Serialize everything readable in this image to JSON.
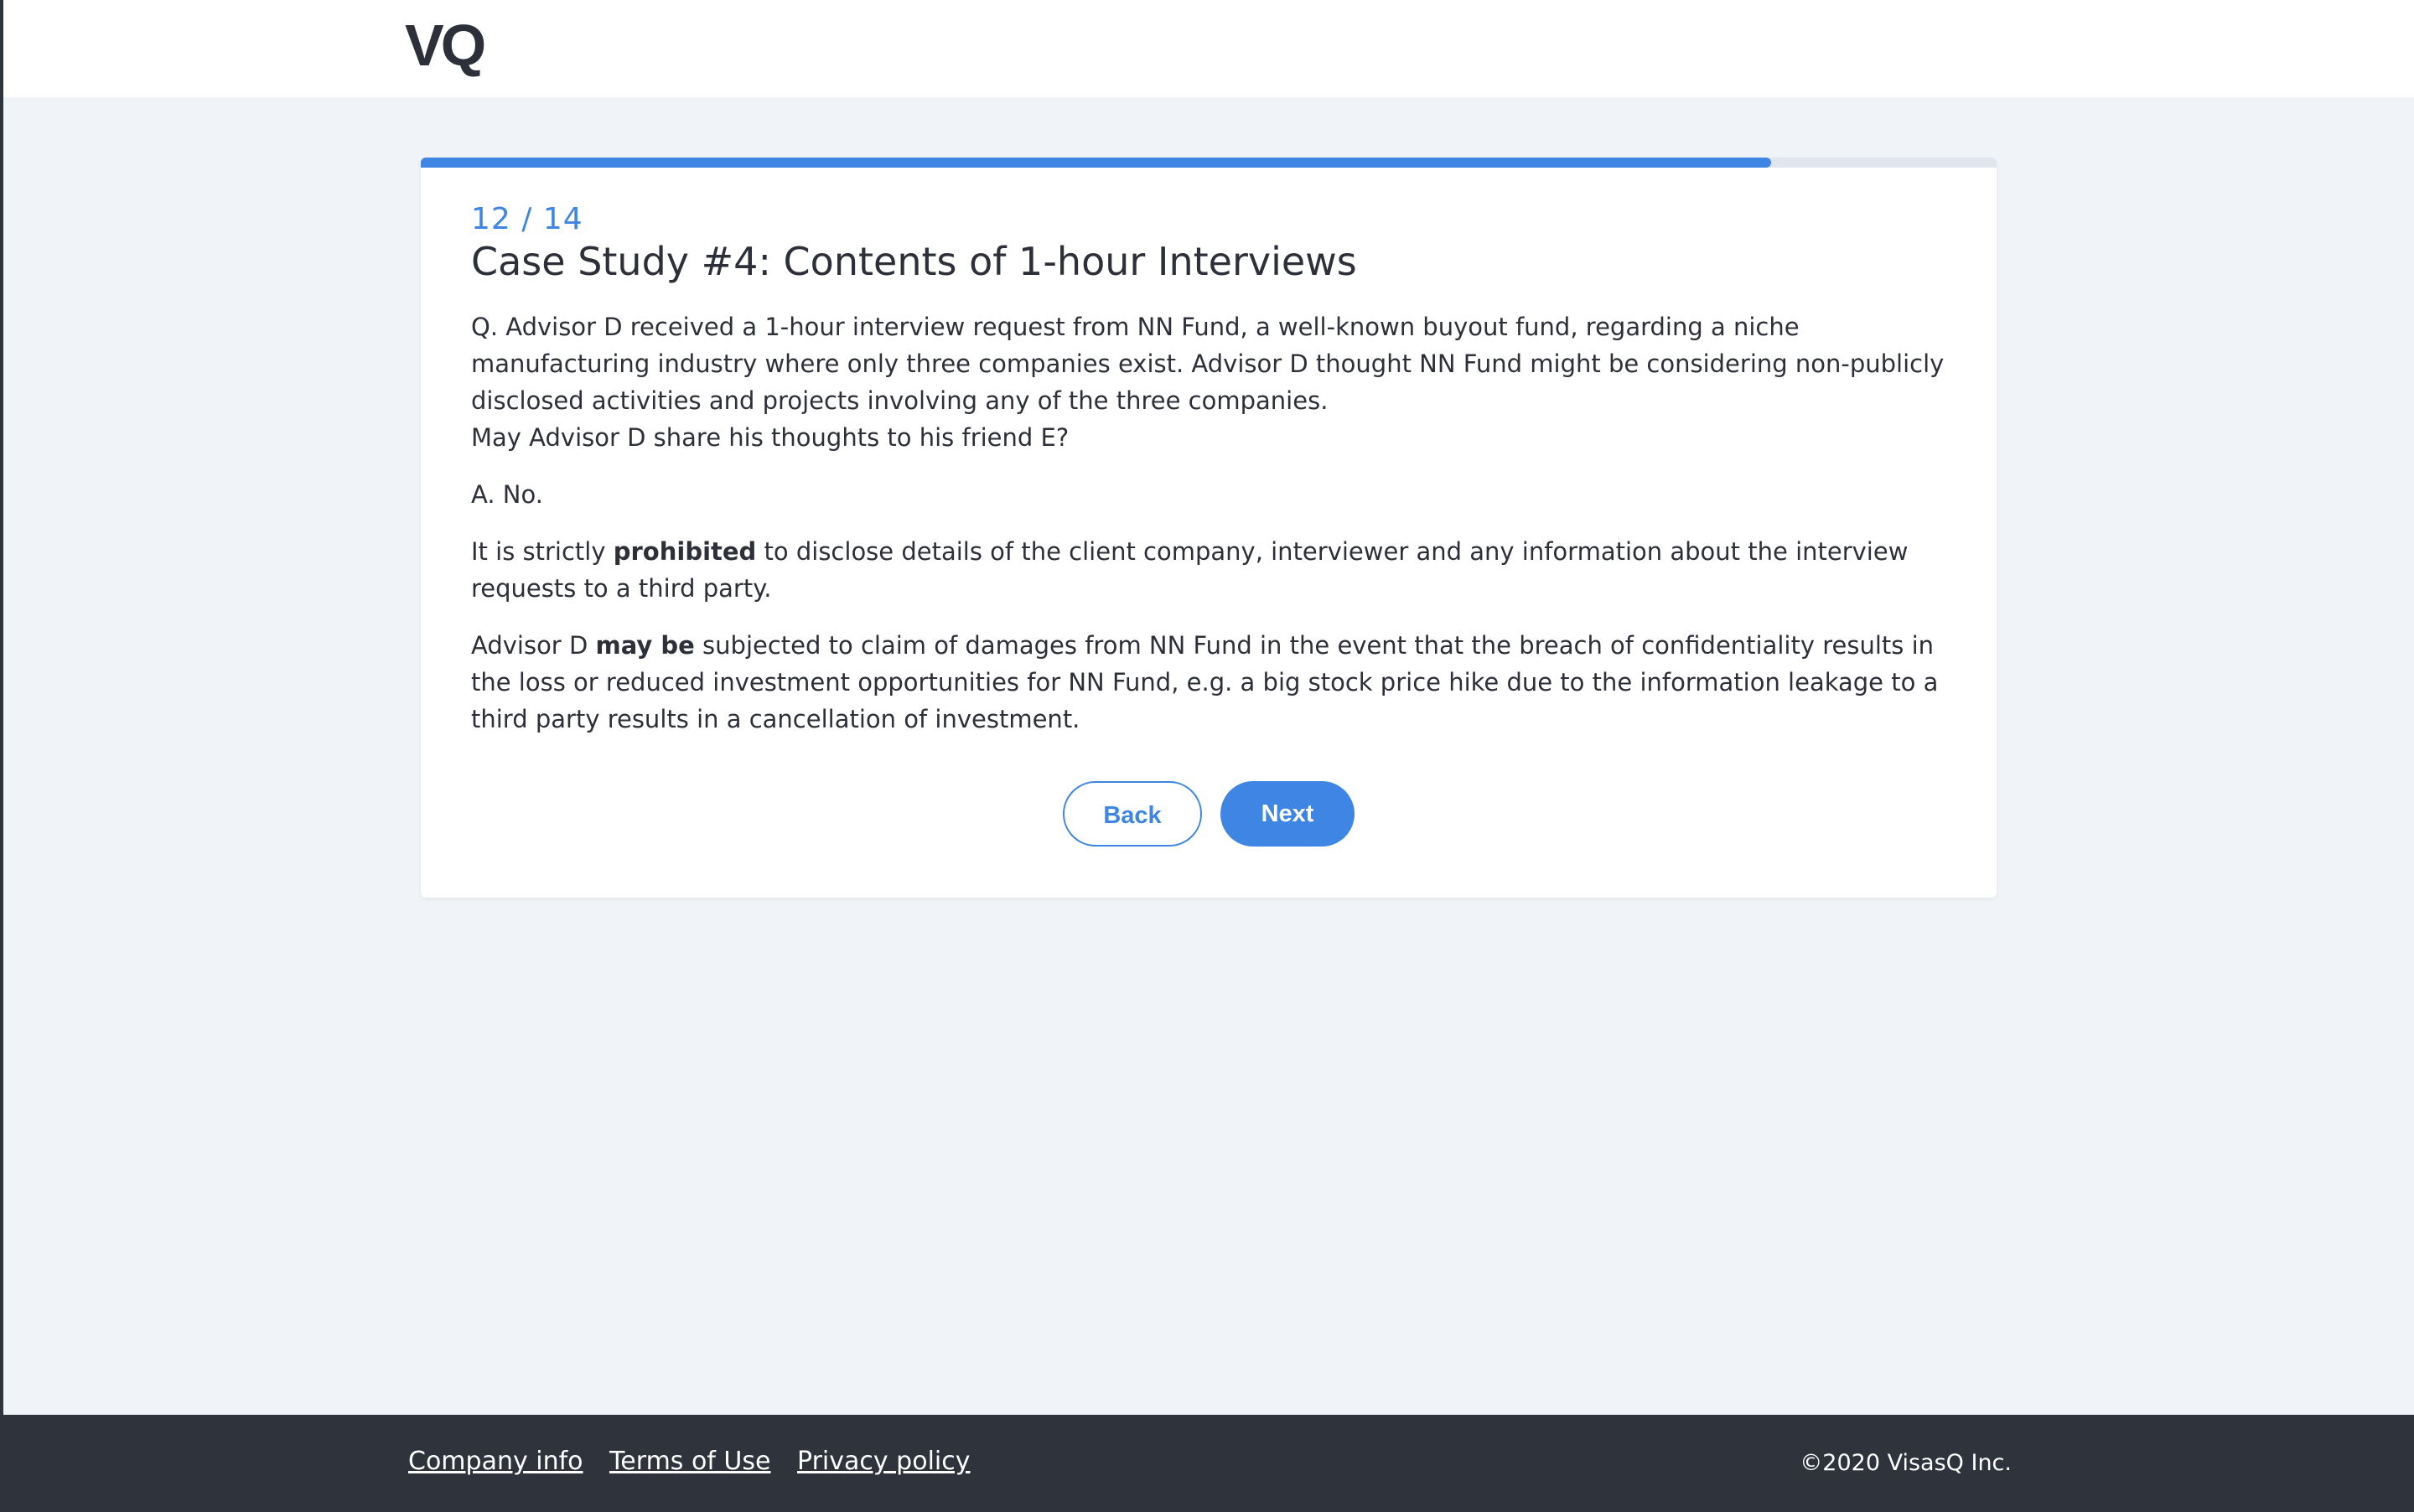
{
  "header": {
    "logo_text": "VQ"
  },
  "progress": {
    "current": 12,
    "total": 14,
    "fraction": 0.857,
    "label": "12 / 14",
    "fill_color": "#3f86e4"
  },
  "content": {
    "title": "Case Study #4: Contents of 1-hour Interviews",
    "question_lines": [
      "Q. Advisor D received a 1-hour interview request from NN Fund, a well-known buyout fund, regarding a niche manufacturing industry where only three companies exist. Advisor D thought NN Fund might be considering non-publicly disclosed activities and projects involving any of the three companies.",
      "May Advisor D share his thoughts to his friend E?"
    ],
    "answer": "A. No.",
    "para1": {
      "before": "It is strictly ",
      "strong": "prohibited",
      "after": " to disclose details of the client company, interviewer and any information about the interview requests to a third party."
    },
    "para2": {
      "before": "Advisor D ",
      "strong": "may be",
      "after": " subjected to claim of damages from NN Fund in the event that the breach of confidentiality results in the loss or reduced investment opportunities for NN Fund, e.g. a big stock price hike due to the information leakage to a third party results in a cancellation of investment."
    }
  },
  "buttons": {
    "back_label": "Back",
    "next_label": "Next"
  },
  "footer": {
    "links": [
      "Company info",
      "Terms of Use",
      "Privacy policy"
    ],
    "copyright": "©2020 VisasQ Inc."
  },
  "colors": {
    "accent": "#3f86e4",
    "footer_bg": "#2f333c",
    "page_bg": "#f0f3f8"
  }
}
